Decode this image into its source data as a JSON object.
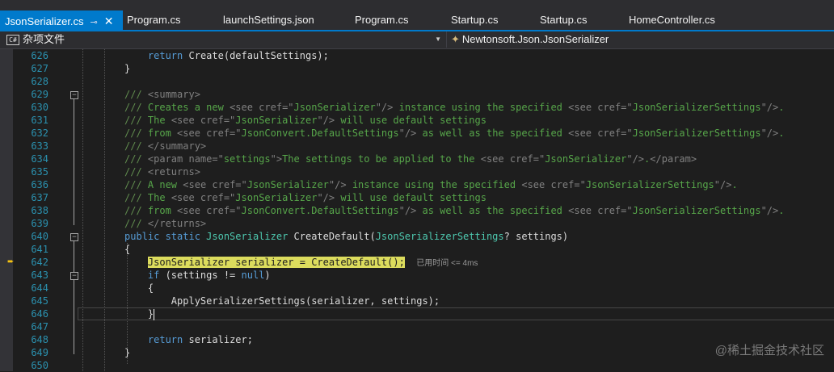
{
  "tabs": [
    {
      "label": "JsonSerializer.cs",
      "active": true,
      "pin": "⊸",
      "close": "✕"
    },
    {
      "label": "Program.cs"
    },
    {
      "label": "launchSettings.json"
    },
    {
      "label": "Program.cs"
    },
    {
      "label": "Startup.cs"
    },
    {
      "label": "Startup.cs"
    },
    {
      "label": "HomeController.cs"
    }
  ],
  "navbar": {
    "project_icon": "C#",
    "project": "杂项文件",
    "type": "Newtonsoft.Json.JsonSerializer"
  },
  "line_numbers": [
    "626",
    "627",
    "628",
    "629",
    "630",
    "631",
    "632",
    "633",
    "634",
    "635",
    "636",
    "637",
    "638",
    "639",
    "640",
    "641",
    "642",
    "643",
    "644",
    "645",
    "646",
    "647",
    "648",
    "649",
    "650"
  ],
  "code": {
    "l626_kw": "return",
    "l626_rest": " Create(defaultSettings);",
    "l627": "}",
    "l629_a": "/// ",
    "l629_b": "<summary>",
    "l630_a": "/// ",
    "l630_b": "Creates a new ",
    "l630_c": "<see cref=\"",
    "l630_d": "JsonSerializer",
    "l630_e": "\"/>",
    "l630_f": " instance using the specified ",
    "l630_g": "<see cref=\"",
    "l630_h": "JsonSerializerSettings",
    "l630_i": "\"/>",
    ".": ".",
    "l630_j": ".",
    "l631_a": "/// ",
    "l631_b": "The ",
    "l631_c": "<see cref=\"",
    "l631_d": "JsonSerializer",
    "l631_e": "\"/>",
    "l631_f": " will use default settings",
    "l632_a": "/// ",
    "l632_b": "from ",
    "l632_c": "<see cref=\"",
    "l632_d": "JsonConvert.DefaultSettings",
    "l632_e": "\"/>",
    "l632_f": " as well as the specified ",
    "l632_g": "<see cref=\"",
    "l632_h": "JsonSerializerSettings",
    "l632_i": "\"/>",
    "l632_j": ".",
    "l633_a": "/// ",
    "l633_b": "</summary>",
    "l634_a": "/// ",
    "l634_b": "<param name=\"",
    "l634_c": "settings",
    "l634_d": "\">",
    "l634_e": "The settings to be applied to the ",
    "l634_f": "<see cref=\"",
    "l634_g": "JsonSerializer",
    "l634_h": "\"/>",
    "l634_i": ".",
    "l634_j": "</param>",
    "l635_a": "/// ",
    "l635_b": "<returns>",
    "l636_a": "/// ",
    "l636_b": "A new ",
    "l636_c": "<see cref=\"",
    "l636_d": "JsonSerializer",
    "l636_e": "\"/>",
    "l636_f": " instance using the specified ",
    "l636_g": "<see cref=\"",
    "l636_h": "JsonSerializerSettings",
    "l636_i": "\"/>",
    "l636_j": ".",
    "l637_a": "/// ",
    "l637_b": "The ",
    "l637_c": "<see cref=\"",
    "l637_d": "JsonSerializer",
    "l637_e": "\"/>",
    "l637_f": " will use default settings",
    "l638_a": "/// ",
    "l638_b": "from ",
    "l638_c": "<see cref=\"",
    "l638_d": "JsonConvert.DefaultSettings",
    "l638_e": "\"/>",
    "l638_f": " as well as the specified ",
    "l638_g": "<see cref=\"",
    "l638_h": "JsonSerializerSettings",
    "l638_i": "\"/>",
    "l638_j": ".",
    "l639_a": "/// ",
    "l639_b": "</returns>",
    "l640_a": "public static ",
    "l640_b": "JsonSerializer",
    "l640_c": " CreateDefault(",
    "l640_d": "JsonSerializerSettings",
    "l640_e": "? settings)",
    "l641": "{",
    "l642_a": "JsonSerializer",
    "l642_b": " serializer = CreateDefault();",
    "l642_perf": "已用时间 <= 4ms",
    "l643_a": "if",
    "l643_b": " (settings != ",
    "l643_c": "null",
    ")": ")",
    "l643_d": ")",
    "l644": "{",
    "l645": "ApplySerializerSettings(serializer, settings);",
    "l646": "}",
    "l648_a": "return",
    "l648_b": " serializer;",
    "l649": "}"
  },
  "watermark": "@稀土掘金技术社区"
}
